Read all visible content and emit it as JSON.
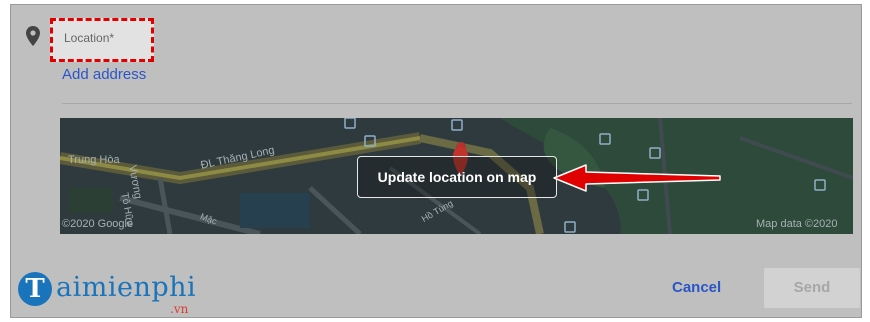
{
  "form": {
    "location_label": "Location*",
    "add_address": "Add address"
  },
  "map": {
    "update_button": "Update location on map",
    "street_labels": [
      "Trung Hòa",
      "ĐL Thăng Long",
      "Vương",
      "Mặc",
      "Tô Hữu",
      "Hồ Tùng"
    ],
    "attribution_left": "©2020 Google",
    "attribution_right": "Map data ©2020"
  },
  "actions": {
    "cancel": "Cancel",
    "send": "Send"
  },
  "watermark": {
    "brand": "aimienphi",
    "brand_initial": "T",
    "suffix": ".vn"
  },
  "colors": {
    "link_blue": "#2a56c6",
    "highlight_red": "#e00000",
    "overlay_gray": "#bfbfbf"
  }
}
